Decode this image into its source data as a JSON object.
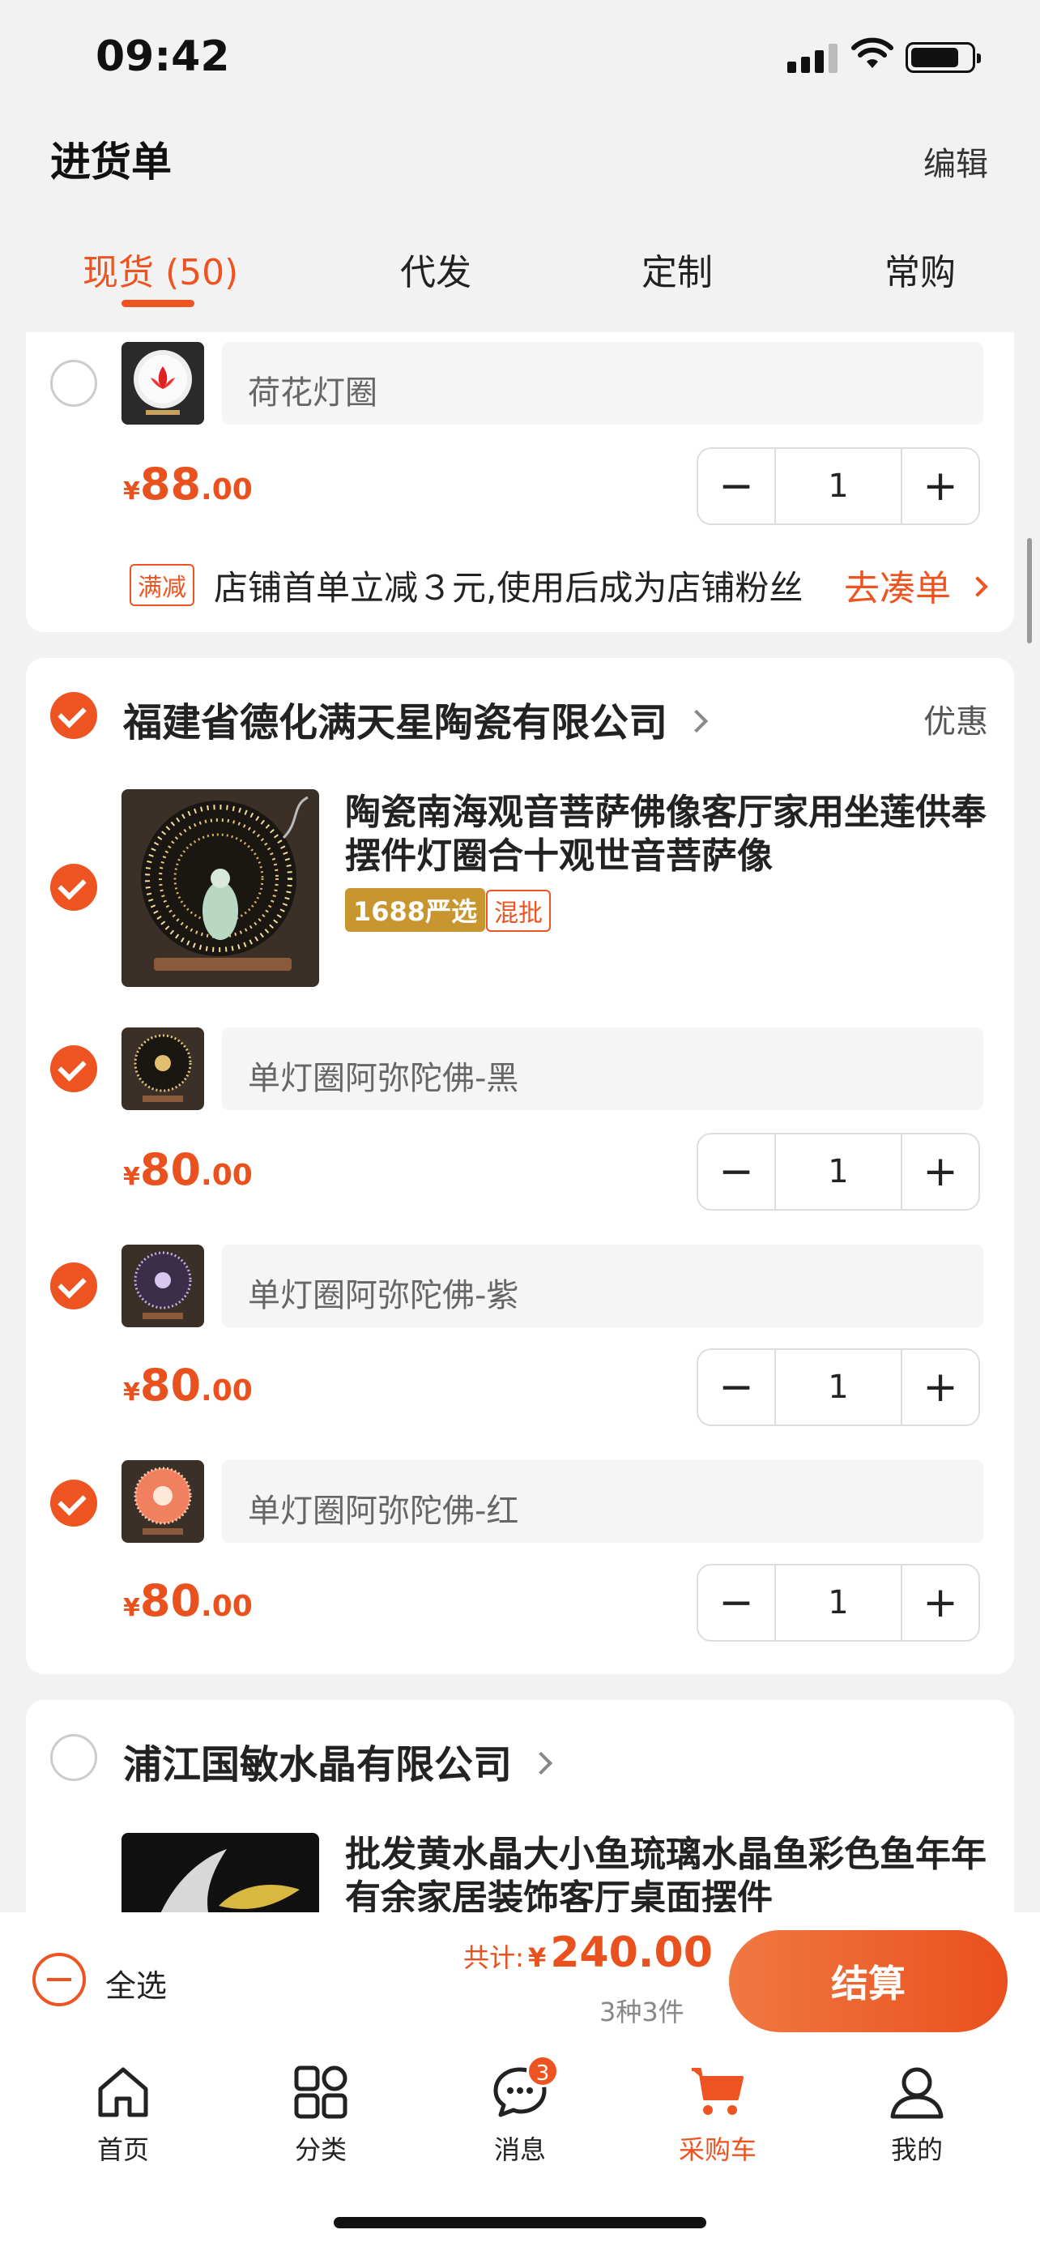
{
  "status": {
    "time": "09:42"
  },
  "header": {
    "title": "进货单",
    "edit": "编辑"
  },
  "tabs": [
    {
      "label": "现货 (50)",
      "active": true
    },
    {
      "label": "代发"
    },
    {
      "label": "定制"
    },
    {
      "label": "常购"
    }
  ],
  "card1": {
    "sku": "荷花灯圈",
    "price": {
      "currency": "¥",
      "int": "88",
      "dec": ".00"
    },
    "qty": "1",
    "promo": {
      "tag": "满减",
      "text": "店铺首单立减３元,使用后成为店铺粉丝",
      "action": "去凑单"
    }
  },
  "card2": {
    "shop": "福建省德化满天星陶瓷有限公司",
    "discount": "优惠",
    "product_title": "陶瓷南海观音菩萨佛像客厅家用坐莲供奉摆件灯圈合十观世音菩萨像",
    "badge_yanxuan": "1688严选",
    "badge_mix": "混批",
    "skus": [
      {
        "name": "单灯圈阿弥陀佛-黑",
        "price_cur": "¥",
        "price_int": "80",
        "price_dec": ".00",
        "qty": "1"
      },
      {
        "name": "单灯圈阿弥陀佛-紫",
        "price_cur": "¥",
        "price_int": "80",
        "price_dec": ".00",
        "qty": "1"
      },
      {
        "name": "单灯圈阿弥陀佛-红",
        "price_cur": "¥",
        "price_int": "80",
        "price_dec": ".00",
        "qty": "1"
      }
    ]
  },
  "card3": {
    "shop": "浦江国敏水晶有限公司",
    "product_title": "批发黄水晶大小鱼琉璃水晶鱼彩色鱼年年有余家居装饰客厅桌面摆件"
  },
  "checkout": {
    "select_all": "全选",
    "total_label": "共计:",
    "total_currency": "¥",
    "total_value": "240.00",
    "count": "3种3件",
    "submit": "结算"
  },
  "tabbar": [
    {
      "label": "首页",
      "icon": "home-icon"
    },
    {
      "label": "分类",
      "icon": "grid-icon"
    },
    {
      "label": "消息",
      "icon": "message-icon",
      "badge": "3"
    },
    {
      "label": "采购车",
      "icon": "cart-icon",
      "active": true
    },
    {
      "label": "我的",
      "icon": "user-icon"
    }
  ],
  "colors": {
    "accent": "#ee5422",
    "background": "#f2f2f2",
    "gold": "#c8962e"
  }
}
